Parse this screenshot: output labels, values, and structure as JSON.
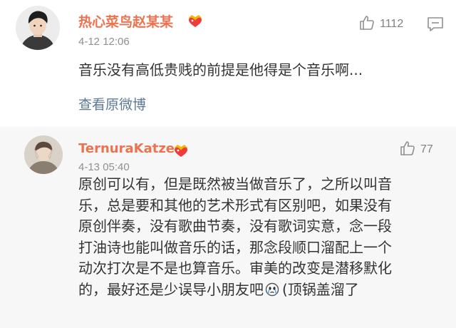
{
  "colors": {
    "username": "#eb7350",
    "link": "#5d7895",
    "meta": "#909090",
    "body_text": "#333333",
    "reply_background": "#f7f7f7"
  },
  "comments": [
    {
      "username": "热心菜鸟赵某某",
      "badge_icon": "vip-crown-heart-icon",
      "time": "4-12 12:06",
      "likes": "1112",
      "text": "音乐没有高低贵贱的前提是他得是个音乐啊...",
      "view_original": "查看原微博"
    },
    {
      "username": "TernuraKatze",
      "badge_icon": "vip-crown-heart-icon",
      "time": "4-13 05:40",
      "likes": "77",
      "lines": [
        "原创可以有，但是既然被当做音乐了，之所以叫音",
        "乐，总是要和其他的艺术形式有区别吧，如果没有",
        "原创伴奏，没有歌曲节奏，没有歌词实意，念一段",
        "打油诗也能叫做音乐的话，那念段顺口溜配上一个",
        "动次打次是不是也算音乐。审美的改变是潜移默化",
        "的，最好还是少误导小朋友吧",
        "(顶锅盖溜了"
      ],
      "inline_emoji_icon": "crying-face-icon"
    }
  ]
}
